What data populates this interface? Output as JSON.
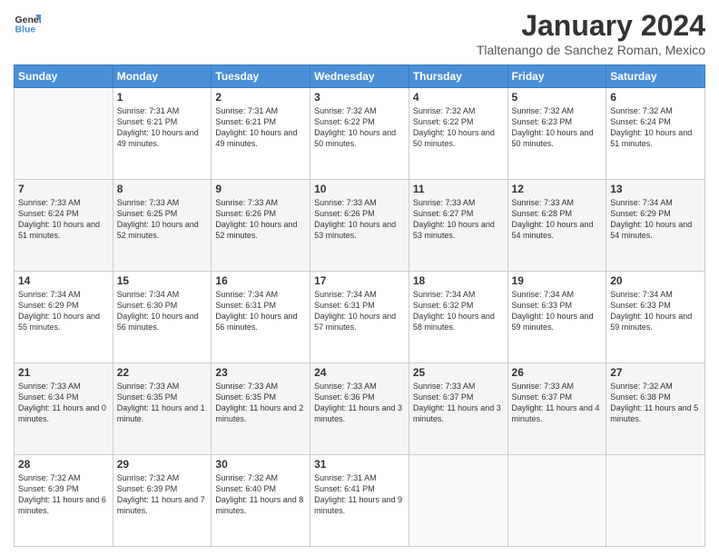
{
  "header": {
    "logo_general": "General",
    "logo_blue": "Blue",
    "month_year": "January 2024",
    "location": "Tlaltenango de Sanchez Roman, Mexico"
  },
  "days": [
    "Sunday",
    "Monday",
    "Tuesday",
    "Wednesday",
    "Thursday",
    "Friday",
    "Saturday"
  ],
  "weeks": [
    [
      {
        "num": "",
        "sunrise": "",
        "sunset": "",
        "daylight": ""
      },
      {
        "num": "1",
        "sunrise": "Sunrise: 7:31 AM",
        "sunset": "Sunset: 6:21 PM",
        "daylight": "Daylight: 10 hours and 49 minutes."
      },
      {
        "num": "2",
        "sunrise": "Sunrise: 7:31 AM",
        "sunset": "Sunset: 6:21 PM",
        "daylight": "Daylight: 10 hours and 49 minutes."
      },
      {
        "num": "3",
        "sunrise": "Sunrise: 7:32 AM",
        "sunset": "Sunset: 6:22 PM",
        "daylight": "Daylight: 10 hours and 50 minutes."
      },
      {
        "num": "4",
        "sunrise": "Sunrise: 7:32 AM",
        "sunset": "Sunset: 6:22 PM",
        "daylight": "Daylight: 10 hours and 50 minutes."
      },
      {
        "num": "5",
        "sunrise": "Sunrise: 7:32 AM",
        "sunset": "Sunset: 6:23 PM",
        "daylight": "Daylight: 10 hours and 50 minutes."
      },
      {
        "num": "6",
        "sunrise": "Sunrise: 7:32 AM",
        "sunset": "Sunset: 6:24 PM",
        "daylight": "Daylight: 10 hours and 51 minutes."
      }
    ],
    [
      {
        "num": "7",
        "sunrise": "Sunrise: 7:33 AM",
        "sunset": "Sunset: 6:24 PM",
        "daylight": "Daylight: 10 hours and 51 minutes."
      },
      {
        "num": "8",
        "sunrise": "Sunrise: 7:33 AM",
        "sunset": "Sunset: 6:25 PM",
        "daylight": "Daylight: 10 hours and 52 minutes."
      },
      {
        "num": "9",
        "sunrise": "Sunrise: 7:33 AM",
        "sunset": "Sunset: 6:26 PM",
        "daylight": "Daylight: 10 hours and 52 minutes."
      },
      {
        "num": "10",
        "sunrise": "Sunrise: 7:33 AM",
        "sunset": "Sunset: 6:26 PM",
        "daylight": "Daylight: 10 hours and 53 minutes."
      },
      {
        "num": "11",
        "sunrise": "Sunrise: 7:33 AM",
        "sunset": "Sunset: 6:27 PM",
        "daylight": "Daylight: 10 hours and 53 minutes."
      },
      {
        "num": "12",
        "sunrise": "Sunrise: 7:33 AM",
        "sunset": "Sunset: 6:28 PM",
        "daylight": "Daylight: 10 hours and 54 minutes."
      },
      {
        "num": "13",
        "sunrise": "Sunrise: 7:34 AM",
        "sunset": "Sunset: 6:29 PM",
        "daylight": "Daylight: 10 hours and 54 minutes."
      }
    ],
    [
      {
        "num": "14",
        "sunrise": "Sunrise: 7:34 AM",
        "sunset": "Sunset: 6:29 PM",
        "daylight": "Daylight: 10 hours and 55 minutes."
      },
      {
        "num": "15",
        "sunrise": "Sunrise: 7:34 AM",
        "sunset": "Sunset: 6:30 PM",
        "daylight": "Daylight: 10 hours and 56 minutes."
      },
      {
        "num": "16",
        "sunrise": "Sunrise: 7:34 AM",
        "sunset": "Sunset: 6:31 PM",
        "daylight": "Daylight: 10 hours and 56 minutes."
      },
      {
        "num": "17",
        "sunrise": "Sunrise: 7:34 AM",
        "sunset": "Sunset: 6:31 PM",
        "daylight": "Daylight: 10 hours and 57 minutes."
      },
      {
        "num": "18",
        "sunrise": "Sunrise: 7:34 AM",
        "sunset": "Sunset: 6:32 PM",
        "daylight": "Daylight: 10 hours and 58 minutes."
      },
      {
        "num": "19",
        "sunrise": "Sunrise: 7:34 AM",
        "sunset": "Sunset: 6:33 PM",
        "daylight": "Daylight: 10 hours and 59 minutes."
      },
      {
        "num": "20",
        "sunrise": "Sunrise: 7:34 AM",
        "sunset": "Sunset: 6:33 PM",
        "daylight": "Daylight: 10 hours and 59 minutes."
      }
    ],
    [
      {
        "num": "21",
        "sunrise": "Sunrise: 7:33 AM",
        "sunset": "Sunset: 6:34 PM",
        "daylight": "Daylight: 11 hours and 0 minutes."
      },
      {
        "num": "22",
        "sunrise": "Sunrise: 7:33 AM",
        "sunset": "Sunset: 6:35 PM",
        "daylight": "Daylight: 11 hours and 1 minute."
      },
      {
        "num": "23",
        "sunrise": "Sunrise: 7:33 AM",
        "sunset": "Sunset: 6:35 PM",
        "daylight": "Daylight: 11 hours and 2 minutes."
      },
      {
        "num": "24",
        "sunrise": "Sunrise: 7:33 AM",
        "sunset": "Sunset: 6:36 PM",
        "daylight": "Daylight: 11 hours and 3 minutes."
      },
      {
        "num": "25",
        "sunrise": "Sunrise: 7:33 AM",
        "sunset": "Sunset: 6:37 PM",
        "daylight": "Daylight: 11 hours and 3 minutes."
      },
      {
        "num": "26",
        "sunrise": "Sunrise: 7:33 AM",
        "sunset": "Sunset: 6:37 PM",
        "daylight": "Daylight: 11 hours and 4 minutes."
      },
      {
        "num": "27",
        "sunrise": "Sunrise: 7:32 AM",
        "sunset": "Sunset: 6:38 PM",
        "daylight": "Daylight: 11 hours and 5 minutes."
      }
    ],
    [
      {
        "num": "28",
        "sunrise": "Sunrise: 7:32 AM",
        "sunset": "Sunset: 6:39 PM",
        "daylight": "Daylight: 11 hours and 6 minutes."
      },
      {
        "num": "29",
        "sunrise": "Sunrise: 7:32 AM",
        "sunset": "Sunset: 6:39 PM",
        "daylight": "Daylight: 11 hours and 7 minutes."
      },
      {
        "num": "30",
        "sunrise": "Sunrise: 7:32 AM",
        "sunset": "Sunset: 6:40 PM",
        "daylight": "Daylight: 11 hours and 8 minutes."
      },
      {
        "num": "31",
        "sunrise": "Sunrise: 7:31 AM",
        "sunset": "Sunset: 6:41 PM",
        "daylight": "Daylight: 11 hours and 9 minutes."
      },
      {
        "num": "",
        "sunrise": "",
        "sunset": "",
        "daylight": ""
      },
      {
        "num": "",
        "sunrise": "",
        "sunset": "",
        "daylight": ""
      },
      {
        "num": "",
        "sunrise": "",
        "sunset": "",
        "daylight": ""
      }
    ]
  ]
}
